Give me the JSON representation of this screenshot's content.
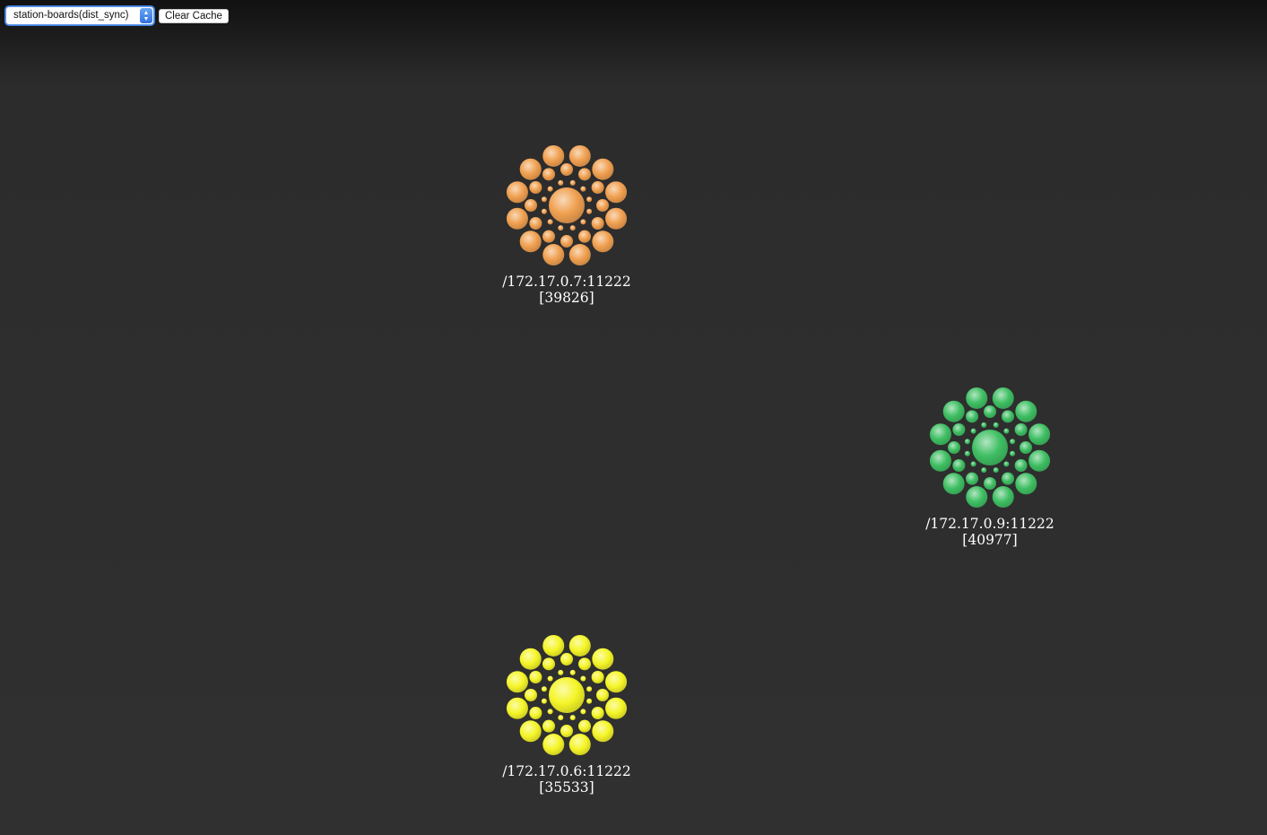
{
  "toolbar": {
    "cache_select": {
      "selected": "station-boards(dist_sync)",
      "icon": "up-down-chevron-icon"
    },
    "clear_cache_label": "Clear Cache"
  },
  "nodes": [
    {
      "address": "/172.17.0.7:11222",
      "count": "[39826]",
      "color": "#f0a050",
      "icon": "cluster-node-icon"
    },
    {
      "address": "/172.17.0.9:11222",
      "count": "[40977]",
      "color": "#3fbf63",
      "icon": "cluster-node-icon"
    },
    {
      "address": "/172.17.0.6:11222",
      "count": "[35533]",
      "color": "#f5f528",
      "icon": "cluster-node-icon"
    }
  ]
}
